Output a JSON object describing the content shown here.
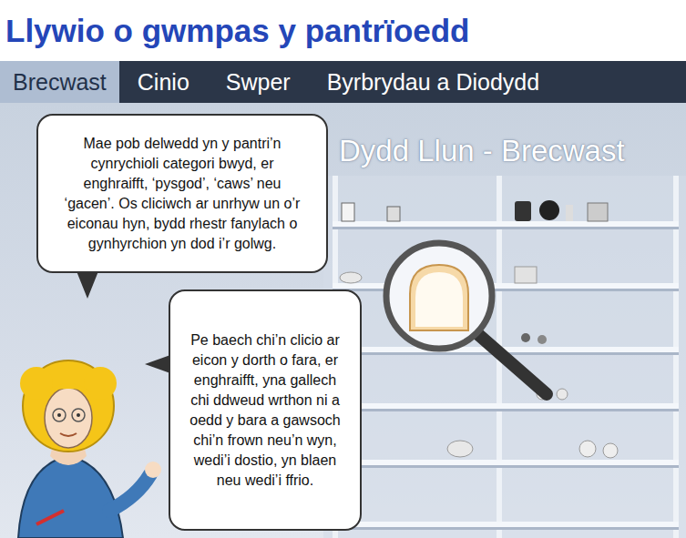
{
  "title": "Llywio o gwmpas y pantrïoedd",
  "tabs": [
    {
      "label": "Brecwast",
      "selected": true
    },
    {
      "label": "Cinio",
      "selected": false
    },
    {
      "label": "Swper",
      "selected": false
    },
    {
      "label": "Byrbrydau a Diodydd",
      "selected": false
    }
  ],
  "scene": {
    "heading": "Dydd Llun - Brecwast"
  },
  "bubbles": [
    {
      "text": "Mae pob delwedd yn y pantri’n cynrychioli categori bwyd, er enghraifft, ‘pysgod’, ‘caws’ neu ‘gacen’. Os cliciwch ar unrhyw un o’r eiconau hyn, bydd rhestr fanylach o gynhyrchion yn dod i’r golwg."
    },
    {
      "text": "Pe baech chi’n clicio ar eicon y dorth o fara, er enghraifft, yna gallech chi ddweud wrthon ni a oedd y bara a gawsoch chi’n frown neu’n wyn, wedi’i dostio, yn blaen neu wedi’i ffrio."
    }
  ]
}
